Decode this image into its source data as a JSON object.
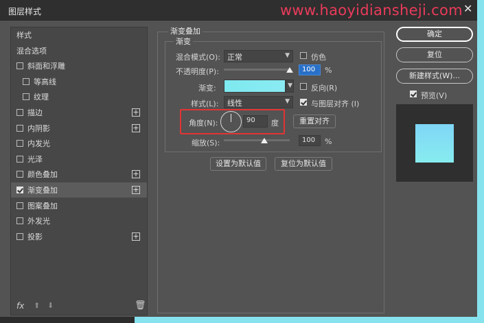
{
  "window": {
    "title": "图层样式",
    "watermark": "www.haoyidiansheji.com",
    "close_glyph": "✕"
  },
  "left_panel": {
    "items": [
      {
        "label": "样式",
        "has_checkbox": false,
        "checked": false,
        "has_plus": false,
        "selected": false
      },
      {
        "label": "混合选项",
        "has_checkbox": false,
        "checked": false,
        "has_plus": false,
        "selected": false
      },
      {
        "label": "斜面和浮雕",
        "has_checkbox": true,
        "checked": false,
        "has_plus": false,
        "selected": false
      },
      {
        "label": "等高线",
        "has_checkbox": true,
        "checked": false,
        "has_plus": false,
        "selected": false,
        "indent": true
      },
      {
        "label": "纹理",
        "has_checkbox": true,
        "checked": false,
        "has_plus": false,
        "selected": false,
        "indent": true
      },
      {
        "label": "描边",
        "has_checkbox": true,
        "checked": false,
        "has_plus": true,
        "selected": false
      },
      {
        "label": "内阴影",
        "has_checkbox": true,
        "checked": false,
        "has_plus": true,
        "selected": false
      },
      {
        "label": "内发光",
        "has_checkbox": true,
        "checked": false,
        "has_plus": false,
        "selected": false
      },
      {
        "label": "光泽",
        "has_checkbox": true,
        "checked": false,
        "has_plus": false,
        "selected": false
      },
      {
        "label": "颜色叠加",
        "has_checkbox": true,
        "checked": false,
        "has_plus": true,
        "selected": false
      },
      {
        "label": "渐变叠加",
        "has_checkbox": true,
        "checked": true,
        "has_plus": true,
        "selected": true
      },
      {
        "label": "图案叠加",
        "has_checkbox": true,
        "checked": false,
        "has_plus": false,
        "selected": false
      },
      {
        "label": "外发光",
        "has_checkbox": true,
        "checked": false,
        "has_plus": false,
        "selected": false
      },
      {
        "label": "投影",
        "has_checkbox": true,
        "checked": false,
        "has_plus": true,
        "selected": false
      }
    ],
    "bottom": {
      "fx": "fx",
      "up": "⬆",
      "down": "⬇",
      "trash": "🗑"
    }
  },
  "gradient_overlay": {
    "section_title": "渐变叠加",
    "group_title": "渐变",
    "blend_mode": {
      "label": "混合模式(O):",
      "value": "正常"
    },
    "dither": {
      "label": "仿色",
      "checked": false
    },
    "opacity": {
      "label": "不透明度(P):",
      "value": "100",
      "unit": "%",
      "level": 1.0
    },
    "gradient": {
      "label": "渐变:",
      "color": "#7ee9f0"
    },
    "reverse": {
      "label": "反向(R)",
      "checked": false
    },
    "style": {
      "label": "样式(L):",
      "value": "线性"
    },
    "align_with_layer": {
      "label": "与图层对齐 (I)",
      "checked": true
    },
    "angle": {
      "label": "角度(N):",
      "value": "90",
      "unit": "度"
    },
    "reset_align_label": "重置对齐",
    "scale": {
      "label": "缩放(S):",
      "value": "100",
      "unit": "%",
      "level": 0.5
    },
    "set_default_label": "设置为默认值",
    "reset_default_label": "复位为默认值"
  },
  "right_panel": {
    "ok_label": "确定",
    "reset_label": "复位",
    "new_style_label": "新建样式(W)...",
    "preview": {
      "label": "预览(V)",
      "checked": true
    }
  },
  "colors": {
    "accent": "#2870c8",
    "highlight_box": "#e23434",
    "gradient_start": "#7fd6f7",
    "gradient_end": "#88ecef"
  }
}
